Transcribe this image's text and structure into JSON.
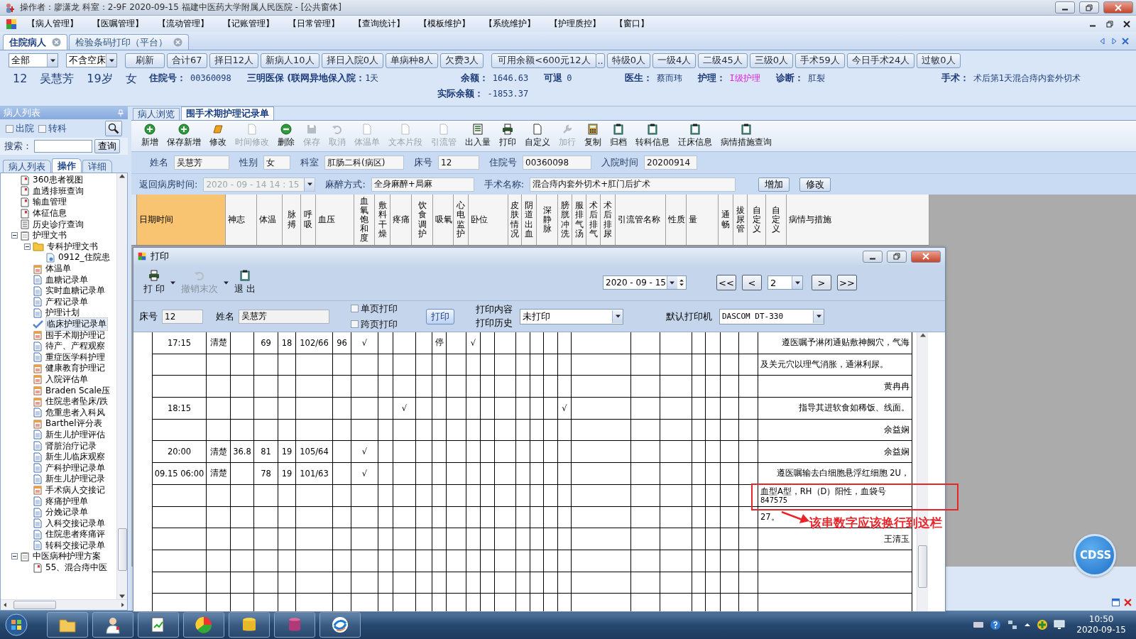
{
  "window": {
    "title": "操作者：廖潇龙  科室：2-9F  2020-09-15  福建中医药大学附属人民医院 - [公共窗体]"
  },
  "menu": [
    "【病人管理】",
    "【医嘱管理】",
    "【流动管理】",
    "【记账管理】",
    "【日常管理】",
    "【查询统计】",
    "【模板维护】",
    "【系统维护】",
    "【护理质控】",
    "【窗口】"
  ],
  "doc_tabs": [
    {
      "label": "住院病人",
      "selected": true
    },
    {
      "label": "检验条码打印（平台）",
      "selected": false
    }
  ],
  "filter": {
    "ward_select": "全部",
    "bed_select": "不含空床",
    "buttons": [
      {
        "label": "刷新",
        "kind": "normal"
      },
      {
        "label": "合计67",
        "kind": "normal"
      },
      {
        "label": "择日12人",
        "kind": "normal"
      },
      {
        "label": "新病人10人",
        "kind": "normal"
      },
      {
        "label": "择日入院0人",
        "kind": "normal"
      },
      {
        "label": "单病种8人",
        "kind": "normal"
      },
      {
        "label": "欠费3人",
        "kind": "normal"
      },
      {
        "label": "可用余额<600元12人",
        "kind": "wide"
      },
      {
        "label": "..",
        "kind": "small"
      },
      {
        "label": "特级0人",
        "kind": "normal"
      },
      {
        "label": "一级4人",
        "kind": "normal"
      },
      {
        "label": "二级45人",
        "kind": "normal"
      },
      {
        "label": "三级0人",
        "kind": "normal"
      },
      {
        "label": "手术59人",
        "kind": "normal"
      },
      {
        "label": "今日手术24人",
        "kind": "normal"
      },
      {
        "label": "过敏0人",
        "kind": "normal"
      }
    ]
  },
  "patient": {
    "bed": "12",
    "name": "吴慧芳",
    "age": "19岁",
    "sex": "女",
    "admission_no": {
      "label": "住院号：",
      "value": "00360098"
    },
    "insurance": "三明医保 (联网异地保",
    "admitted": {
      "label": "入院：",
      "value": "1天"
    },
    "balance": {
      "label": "余额：",
      "value": "1646.63"
    },
    "actual_balance": {
      "label": "实际余额：",
      "value": "-1853.37"
    },
    "refundable": {
      "label": "可退",
      "value": "0"
    },
    "doctor": {
      "label": "医生：",
      "value": "蔡而玮"
    },
    "nursing": {
      "label": "护理：",
      "value": "I级护理"
    },
    "diagnosis": {
      "label": "诊断：",
      "value": "肛裂"
    },
    "surgery": {
      "label": "手术：",
      "value": "术后第1天混合痔内套外切术"
    }
  },
  "left_panel": {
    "title": "病人列表",
    "filters": [
      {
        "label": "出院",
        "checked": false
      },
      {
        "label": "转科",
        "checked": false
      }
    ],
    "search_label": "搜索：",
    "search_button": "查询",
    "tabs": [
      {
        "label": "病人列表",
        "selected": false
      },
      {
        "label": "操作",
        "selected": true
      },
      {
        "label": "详细",
        "selected": false
      }
    ],
    "tree": [
      {
        "label": "360患者视图",
        "kind": "report",
        "selected": false
      },
      {
        "label": "血透排班查询",
        "kind": "report",
        "selected": false
      },
      {
        "label": "输血管理",
        "kind": "report",
        "selected": false
      },
      {
        "label": "体征信息",
        "kind": "report",
        "selected": false
      },
      {
        "label": "历史诊疗查询",
        "kind": "list",
        "selected": false
      },
      {
        "label": "护理文书",
        "kind": "clipboard",
        "selected": false,
        "expanded": true,
        "children": [
          {
            "label": "专科护理文书",
            "kind": "folder",
            "selected": false,
            "expanded": true,
            "children": [
              {
                "label": "0912_住院患",
                "kind": "file",
                "selected": false
              }
            ]
          },
          {
            "label": "体温单",
            "kind": "calendar",
            "selected": false
          },
          {
            "label": "血糖记录单",
            "kind": "document",
            "selected": false
          },
          {
            "label": "实时血糖记录单",
            "kind": "document",
            "selected": false
          },
          {
            "label": "产程记录单",
            "kind": "document",
            "selected": false
          },
          {
            "label": "护理计划",
            "kind": "document",
            "selected": false
          },
          {
            "label": "临床护理记录单",
            "kind": "check",
            "selected": true
          },
          {
            "label": "围手术期护理记",
            "kind": "calendar",
            "selected": false
          },
          {
            "label": "待产、产程观察",
            "kind": "document",
            "selected": false
          },
          {
            "label": "重症医学科护理",
            "kind": "document",
            "selected": false
          },
          {
            "label": "健康教育护理记",
            "kind": "calendar",
            "selected": false
          },
          {
            "label": "入院评估单",
            "kind": "calendar",
            "selected": false
          },
          {
            "label": "Braden Scale压",
            "kind": "calendar",
            "selected": false
          },
          {
            "label": "住院患者坠床/跌",
            "kind": "calendar",
            "selected": false
          },
          {
            "label": "危重患者入科风",
            "kind": "document",
            "selected": false
          },
          {
            "label": "Barthel评分表",
            "kind": "calendar",
            "selected": false
          },
          {
            "label": "新生儿护理评估",
            "kind": "document",
            "selected": false
          },
          {
            "label": "肾脏治疗记录",
            "kind": "document",
            "selected": false
          },
          {
            "label": "新生儿临床观察",
            "kind": "document",
            "selected": false
          },
          {
            "label": "产科护理记录单",
            "kind": "document",
            "selected": false
          },
          {
            "label": "新生儿护理记录",
            "kind": "document",
            "selected": false
          },
          {
            "label": "手术病人交接记",
            "kind": "calendar",
            "selected": false
          },
          {
            "label": "疼痛护理单",
            "kind": "document",
            "selected": false
          },
          {
            "label": "分娩记录单",
            "kind": "document",
            "selected": false
          },
          {
            "label": "入科交接记录单",
            "kind": "document",
            "selected": false
          },
          {
            "label": "住院患者疼痛评",
            "kind": "document",
            "selected": false
          },
          {
            "label": "转科交接记录单",
            "kind": "document",
            "selected": false
          }
        ]
      },
      {
        "label": "中医病种护理方案",
        "kind": "clipboard",
        "selected": false,
        "expanded": true,
        "children": [
          {
            "label": "55、混合痔中医",
            "kind": "report",
            "selected": false
          }
        ]
      }
    ]
  },
  "record_tabs": [
    {
      "label": "病人浏览",
      "selected": false
    },
    {
      "label": "围手术期护理记录单",
      "selected": true
    }
  ],
  "toolbar": [
    {
      "label": "新增",
      "disabled": false
    },
    {
      "label": "保存新增",
      "disabled": false
    },
    {
      "label": "修改",
      "disabled": false
    },
    {
      "label": "时间修改",
      "disabled": true
    },
    {
      "label": "删除",
      "disabled": false
    },
    {
      "label": "保存",
      "disabled": true
    },
    {
      "label": "取消",
      "disabled": true
    },
    {
      "label": "体温单",
      "disabled": true
    },
    {
      "label": "文本片段",
      "disabled": true
    },
    {
      "label": "引流管",
      "disabled": true
    },
    {
      "label": "出入量",
      "disabled": false
    },
    {
      "label": "打印",
      "disabled": false
    },
    {
      "label": "自定义",
      "disabled": false
    },
    {
      "label": "加行",
      "disabled": true
    },
    {
      "label": "复制",
      "disabled": false
    },
    {
      "label": "归档",
      "disabled": false
    },
    {
      "label": "转科信息",
      "disabled": false
    },
    {
      "label": "迁床信息",
      "disabled": false
    },
    {
      "label": "病情措施查询",
      "disabled": false
    }
  ],
  "form": {
    "fields": [
      {
        "label": "姓名",
        "value": "吴慧芳"
      },
      {
        "label": "性别",
        "value": "女"
      },
      {
        "label": "科室",
        "value": "肛肠二科(病区)"
      },
      {
        "label": "床号",
        "value": "12"
      },
      {
        "label": "住院号",
        "value": "00360098"
      },
      {
        "label": "入院时间",
        "value": "20200914"
      }
    ],
    "return_time": {
      "label": "返回病房时间:",
      "value": "2020 - 09 - 14    14 : 15",
      "disabled": true
    },
    "anesthesia": {
      "label": "麻醉方式:",
      "value": "全身麻醉+局麻"
    },
    "surgery_name": {
      "label": "手术名称:",
      "value": "混合痔内套外切术+肛门后扩术"
    },
    "buttons": [
      "增加",
      "修改"
    ]
  },
  "record_table": {
    "columns": [
      "日期时间",
      "神志",
      "体温",
      "脉搏",
      "呼吸",
      "血压",
      "血氧饱和度",
      "敷料干燥",
      "疼痛",
      "饮食调护",
      "吸氧",
      "心电监护",
      "卧位",
      "皮肤情况",
      "阴道出血",
      "深静脉",
      "膀胱冲洗",
      "服排气汤",
      "术后排气",
      "术后排尿",
      "引流管名称",
      "性质",
      "量",
      "通畅",
      "拔尿管",
      "自定义",
      "自定义",
      "病情与措施"
    ]
  },
  "print_dialog": {
    "title": "打印",
    "toolbar": [
      {
        "label": "打 印",
        "disabled": false,
        "dropdown": true
      },
      {
        "label": "撤销末次",
        "disabled": true,
        "dropdown": true
      },
      {
        "label": "退 出",
        "disabled": false,
        "dropdown": false
      }
    ],
    "date": "2020 - 09 - 15",
    "nav_back": [
      "<<",
      "<"
    ],
    "page": "2",
    "nav_forward": [
      ">",
      ">>"
    ],
    "bed": {
      "label": "床号",
      "value": "12"
    },
    "name": {
      "label": "姓名",
      "value": "吴慧芳"
    },
    "options": [
      {
        "label": "单页打印",
        "checked": false
      },
      {
        "label": "跨页打印",
        "checked": false
      }
    ],
    "print_button": "打印",
    "content_labels": [
      "打印内容",
      "打印历史"
    ],
    "content_select": "未打印",
    "printer": {
      "label": "默认打印机",
      "value": "DASCOM DT-330"
    },
    "preview_rows": [
      {
        "kind": "entry",
        "column_1": "17:15",
        "column_2": "清楚",
        "column_4": "69",
        "column_5": "18",
        "column_6": "102/66",
        "column_7": "96",
        "column_8": "√",
        "column_12": "停",
        "column_14": "√",
        "column_28": "遵医嘱予淋闭通贴敷神阙穴，气海"
      },
      {
        "kind": "continued",
        "column_28": "及关元穴以理气消胀，通淋利尿。"
      },
      {
        "kind": "signature",
        "column_28": "黄冉冉"
      },
      {
        "kind": "entry",
        "column_1": "18:15",
        "column_10": "√",
        "column_20": "√",
        "column_28": "指导其进软食如稀饭、线面。"
      },
      {
        "kind": "signature",
        "column_28": "余益娴"
      },
      {
        "kind": "signature",
        "column_1": "20:00",
        "column_2": "清楚",
        "column_3": "36.8",
        "column_4": "81",
        "column_5": "19",
        "column_6": "105/64",
        "column_8": "√",
        "column_28": "余益娴"
      },
      {
        "kind": "entry",
        "column_1": "09.15 06:00",
        "column_2": "清楚",
        "column_4": "78",
        "column_5": "19",
        "column_6": "101/63",
        "column_8": "√",
        "column_28": "遵医嘱输去白细胞悬浮红细胞 2U，"
      },
      {
        "kind": "continued",
        "column_28": "血型A型，RH（D）阳性，血袋号",
        "spill": "847575"
      },
      {
        "kind": "continued",
        "column_28": "27。"
      },
      {
        "kind": "signature",
        "column_28": "王清玉"
      },
      {
        "kind": "blank"
      },
      {
        "kind": "blank"
      },
      {
        "kind": "blank"
      }
    ],
    "annotation": {
      "text": "该串数字应该换行到这栏"
    }
  },
  "cdss_button": "CDSS",
  "taskbar": {
    "time": "10:50",
    "date": "2020-09-15"
  }
}
